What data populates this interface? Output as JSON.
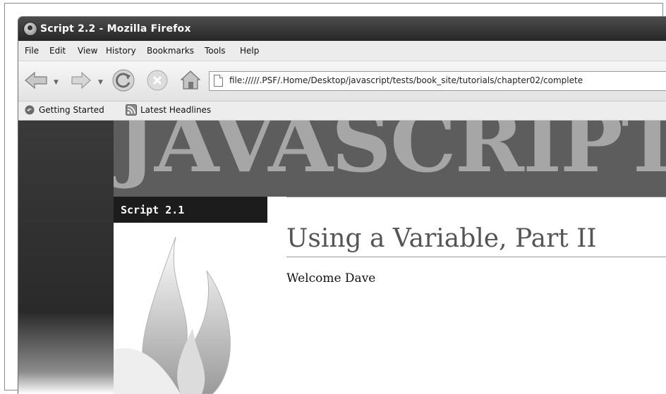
{
  "window": {
    "title": "Script 2.2 - Mozilla Firefox"
  },
  "menu": [
    "File",
    "Edit",
    "View",
    "History",
    "Bookmarks",
    "Tools",
    "Help"
  ],
  "address_bar": {
    "url": "file://///.PSF/.Home/Desktop/javascript/tests/book_site/tutorials/chapter02/complete"
  },
  "bookmarks": [
    {
      "label": "Getting Started",
      "icon": "getting-started-icon"
    },
    {
      "label": "Latest Headlines",
      "icon": "rss-icon"
    }
  ],
  "page": {
    "banner_text": "JAVASCRIPT",
    "script_label": "Script 2.1",
    "heading": "Using a Variable, Part II",
    "welcome": "Welcome Dave"
  }
}
